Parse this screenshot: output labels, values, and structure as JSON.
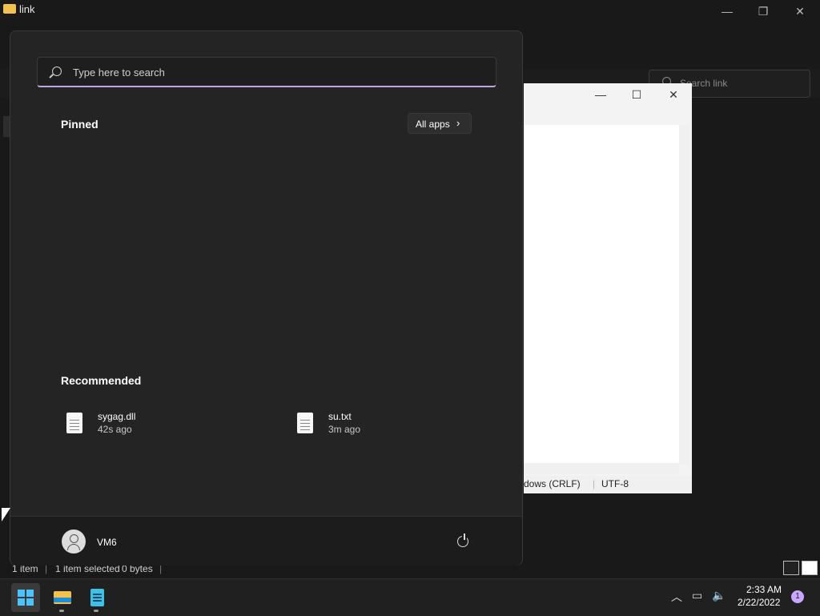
{
  "explorer": {
    "title": "link",
    "search_placeholder": "Search link",
    "status": {
      "items": "1 item",
      "selected": "1 item selected",
      "size": "0 bytes"
    }
  },
  "notepad": {
    "status_eol": "dows (CRLF)",
    "status_encoding": "UTF-8"
  },
  "start_menu": {
    "search_placeholder": "Type here to search",
    "pinned_title": "Pinned",
    "all_apps_label": "All apps",
    "recommended_title": "Recommended",
    "recommended": [
      {
        "name": "sygag.dll",
        "time": "42s ago"
      },
      {
        "name": "su.txt",
        "time": "3m ago"
      }
    ],
    "user_name": "VM6"
  },
  "taskbar": {
    "time": "2:33 AM",
    "date": "2/22/2022",
    "notification_count": "1"
  },
  "icons": [
    "folder-icon",
    "search-icon",
    "chevron-right-icon",
    "file-icon",
    "user-icon",
    "power-icon",
    "windows-start-icon",
    "file-explorer-icon",
    "notepad-icon",
    "chevron-up-icon",
    "network-icon",
    "volume-icon",
    "minimize-icon",
    "maximize-icon",
    "close-icon"
  ]
}
